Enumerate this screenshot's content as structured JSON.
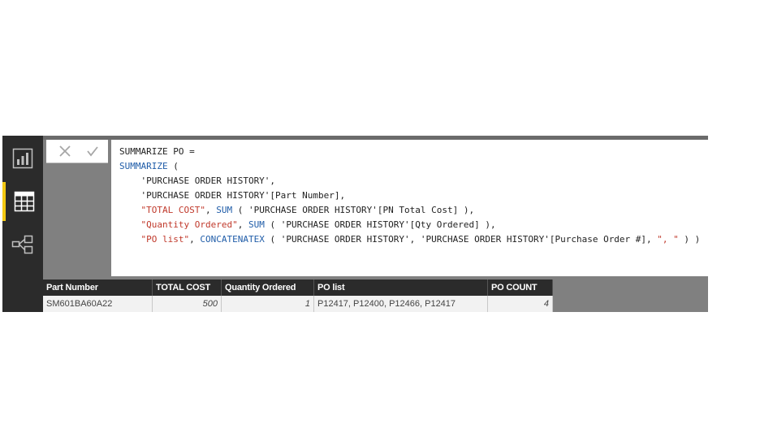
{
  "formula": {
    "lines": [
      [
        {
          "t": "SUMMARIZE PO ="
        }
      ],
      [
        {
          "t": "SUMMARIZE",
          "k": "fn"
        },
        {
          "t": " ("
        }
      ],
      [
        {
          "t": "    'PURCHASE ORDER HISTORY',"
        }
      ],
      [
        {
          "t": "    'PURCHASE ORDER HISTORY'[Part Number],"
        }
      ],
      [
        {
          "t": "    "
        },
        {
          "t": "\"TOTAL COST\"",
          "k": "str"
        },
        {
          "t": ", "
        },
        {
          "t": "SUM",
          "k": "fn"
        },
        {
          "t": " ( 'PURCHASE ORDER HISTORY'[PN Total Cost] ),"
        }
      ],
      [
        {
          "t": "    "
        },
        {
          "t": "\"Quantity Ordered\"",
          "k": "str"
        },
        {
          "t": ", "
        },
        {
          "t": "SUM",
          "k": "fn"
        },
        {
          "t": " ( 'PURCHASE ORDER HISTORY'[Qty Ordered] ),"
        }
      ],
      [
        {
          "t": "    "
        },
        {
          "t": "\"PO list\"",
          "k": "str"
        },
        {
          "t": ", "
        },
        {
          "t": "CONCATENATEX",
          "k": "fn"
        },
        {
          "t": " ( 'PURCHASE ORDER HISTORY', 'PURCHASE ORDER HISTORY'[Purchase Order #], "
        },
        {
          "t": "\", \"",
          "k": "str"
        },
        {
          "t": " ) )"
        }
      ]
    ]
  },
  "icons": {
    "nav": [
      "report-view-icon",
      "data-view-icon",
      "relationships-view-icon"
    ],
    "cancel": "close-icon",
    "commit": "checkmark-icon",
    "accent": "#f2c811"
  },
  "table": {
    "headers": [
      "Part Number",
      "TOTAL COST",
      "Quantity Ordered",
      "PO list",
      "PO COUNT"
    ],
    "rows": [
      [
        "SM601BA60A22",
        "500",
        "1",
        "P12417, P12400, P12466, P12417",
        "4"
      ]
    ]
  }
}
